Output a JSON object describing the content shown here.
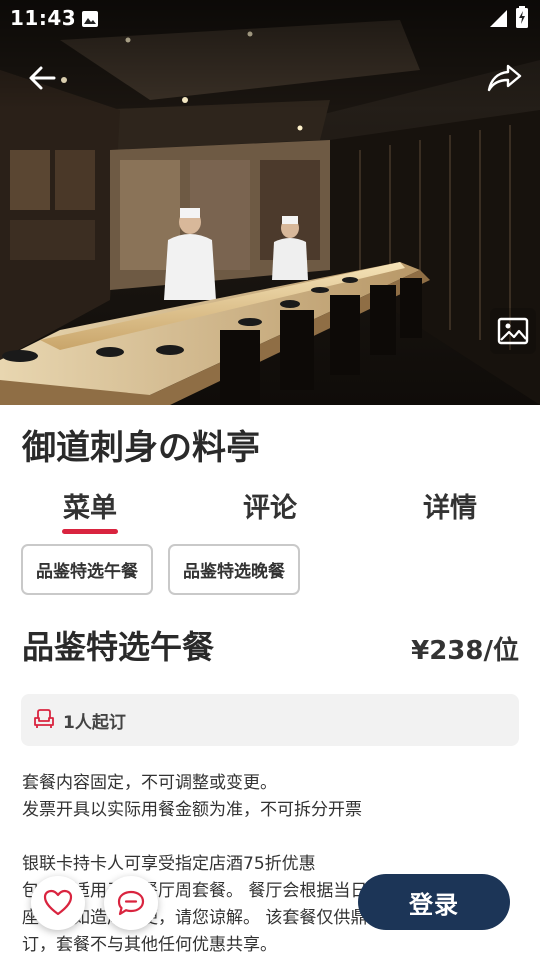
{
  "status_bar": {
    "time": "11:43"
  },
  "restaurant": {
    "name": "御道刺身の料亭"
  },
  "tabs": [
    {
      "label": "菜单",
      "active": true
    },
    {
      "label": "评论",
      "active": false
    },
    {
      "label": "详情",
      "active": false
    }
  ],
  "meal_options": [
    {
      "label": "品鉴特选午餐"
    },
    {
      "label": "品鉴特选晚餐"
    }
  ],
  "selected_meal": {
    "name": "品鉴特选午餐",
    "price": "¥238/位",
    "min_order": "1人起订"
  },
  "description": [
    "套餐内容固定，不可调整或变更。",
    "发票开具以实际用餐金额为准，不可拆分开票",
    "",
    "银联卡持卡人可享受指定店酒75折优惠",
    "包含在适用于本餐厅周套餐。 餐厅会根据当日情况安排",
    "座位，如造成不便，请您谅解。 该套餐仅供鼎悦会员预",
    "订，套餐不与其他任何优惠共享。"
  ],
  "login_button": {
    "label": "登录"
  },
  "colors": {
    "accent_red": "#d9243f",
    "login_bg": "#1c3557",
    "chip_border": "#c9c9c9",
    "info_bg": "#f2f2f2"
  },
  "icons": {
    "back": "arrow-left-icon",
    "share": "share-icon",
    "gallery": "image-gallery-icon",
    "seat": "seat-icon",
    "like": "heart-icon",
    "message": "chat-bubble-icon",
    "notification": "image-notification-icon",
    "wifi": "wifi-icon",
    "signal": "signal-icon",
    "battery": "battery-icon"
  }
}
